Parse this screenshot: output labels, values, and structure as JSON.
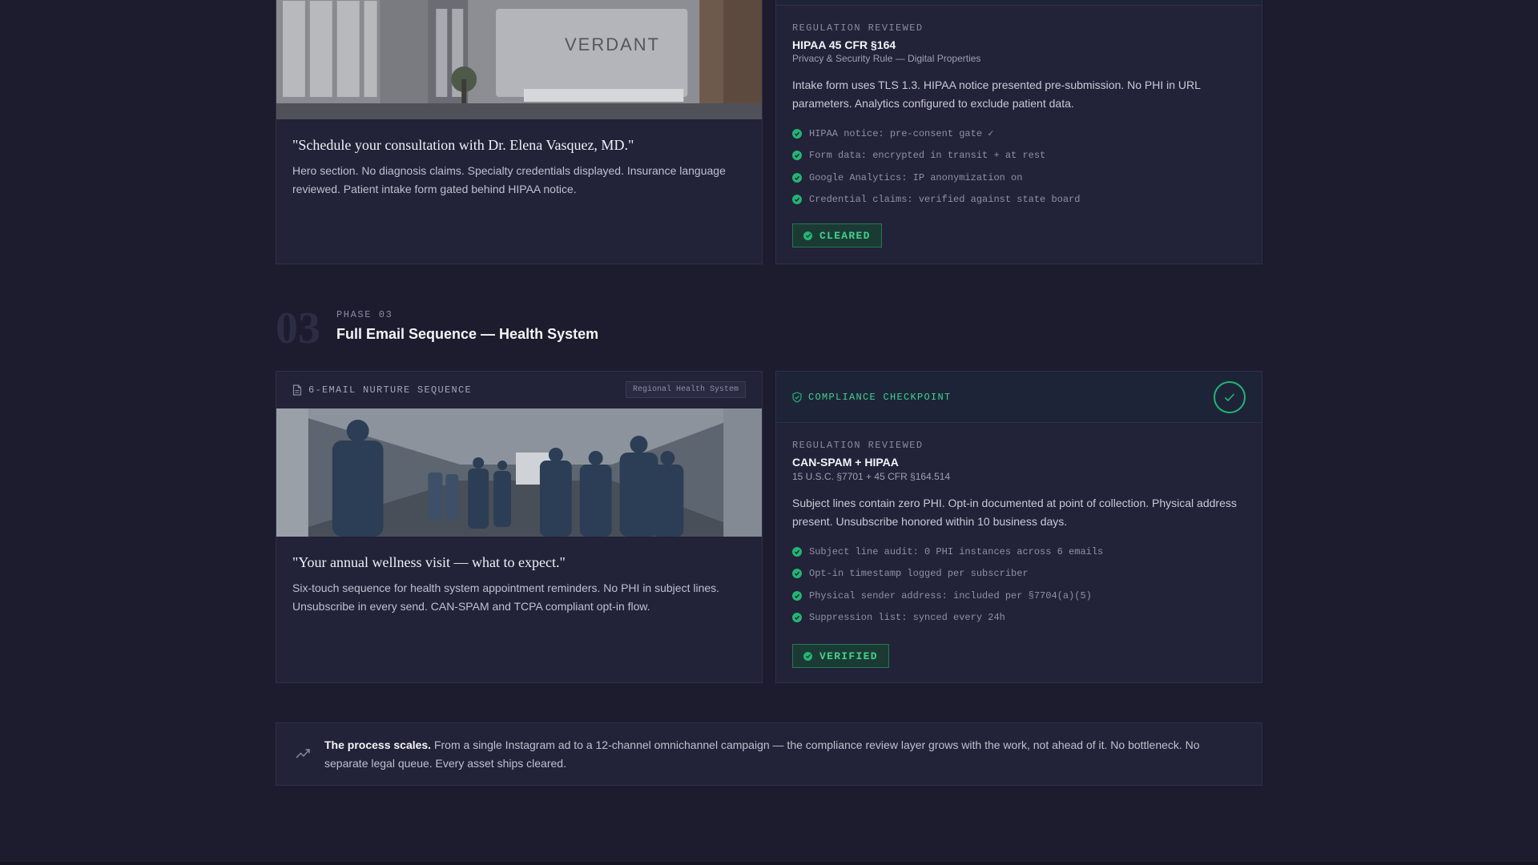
{
  "phase2": {
    "quote": "\"Schedule your consultation with Dr. Elena Vasquez, MD.\"",
    "description": "Hero section. No diagnosis claims. Specialty credentials displayed. Insurance language reviewed. Patient intake form gated behind HIPAA notice.",
    "photo_sign": "VERDANT",
    "checkpoint": {
      "reg_label": "REGULATION REVIEWED",
      "reg_title": "HIPAA 45 CFR §164",
      "reg_sub": "Privacy & Security Rule — Digital Properties",
      "body": "Intake form uses TLS 1.3. HIPAA notice presented pre-submission. No PHI in URL parameters. Analytics configured to exclude patient data.",
      "checks": [
        "HIPAA notice: pre-consent gate ✓",
        "Form data: encrypted in transit + at rest",
        "Google Analytics: IP anonymization on",
        "Credential claims: verified against state board"
      ],
      "status": "CLEARED"
    }
  },
  "phase3": {
    "number": "03",
    "label": "PHASE 03",
    "title": "Full Email Sequence — Health System",
    "asset_label": "6-EMAIL NURTURE SEQUENCE",
    "client_tag": "Regional Health System",
    "quote": "\"Your annual wellness visit — what to expect.\"",
    "description": "Six-touch sequence for health system appointment reminders. No PHI in subject lines. Unsubscribe in every send. CAN-SPAM and TCPA compliant opt-in flow.",
    "checkpoint": {
      "head": "COMPLIANCE CHECKPOINT",
      "reg_label": "REGULATION REVIEWED",
      "reg_title": "CAN-SPAM + HIPAA",
      "reg_sub": "15 U.S.C. §7701 + 45 CFR §164.514",
      "body": "Subject lines contain zero PHI. Opt-in documented at point of collection. Physical address present. Unsubscribe honored within 10 business days.",
      "checks": [
        "Subject line audit: 0 PHI instances across 6 emails",
        "Opt-in timestamp logged per subscriber",
        "Physical sender address: included per §7704(a)(5)",
        "Suppression list: synced every 24h"
      ],
      "status": "VERIFIED"
    }
  },
  "scale": {
    "lead": "The process scales.",
    "text": " From a single Instagram ad to a 12-channel omnichannel campaign — the compliance review layer grows with the work, not ahead of it. No bottleneck. No separate legal queue. Every asset ships cleared."
  },
  "colors": {
    "background": "#1c1c2e",
    "card": "#222238",
    "accent_green": "#22b573",
    "badge_text": "#3fd28f"
  },
  "icons": [
    "check-circle-icon",
    "document-icon",
    "shield-check-icon",
    "trending-up-icon"
  ]
}
